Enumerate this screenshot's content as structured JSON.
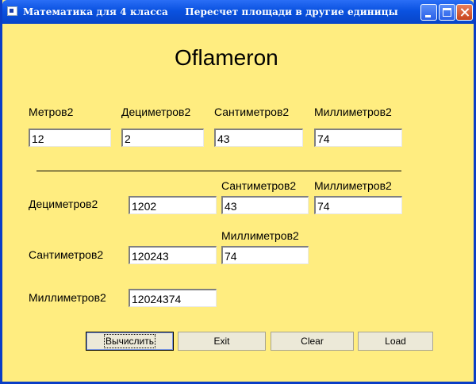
{
  "window": {
    "title": "Математика для 4 класса     Пересчет площади в другие единицы"
  },
  "header": {
    "title": "Oflameron"
  },
  "section_meters": {
    "label_m2": "Метров2",
    "label_dm2": "Дециметров2",
    "label_cm2": "Сантиметров2",
    "label_mm2": "Миллиметров2",
    "value_m2": "12",
    "value_dm2": "2",
    "value_cm2": "43",
    "value_mm2": "74"
  },
  "section_dm": {
    "label": "Дециметров2",
    "label_cm2": "Сантиметров2",
    "label_mm2": "Миллиметров2",
    "value": "1202",
    "value_cm2": "43",
    "value_mm2": "74"
  },
  "section_cm": {
    "label": "Сантиметров2",
    "label_mm2": "Миллиметров2",
    "value": "120243",
    "value_mm2": "74"
  },
  "section_mm": {
    "label": "Миллиметров2",
    "value": "12024374"
  },
  "buttons": {
    "calculate": "Вычислить",
    "exit": "Exit",
    "clear": "Clear",
    "load": "Load"
  },
  "colors": {
    "background": "#ffed80",
    "titlebar": "#0a52e0",
    "button_face": "#ece9d8"
  }
}
